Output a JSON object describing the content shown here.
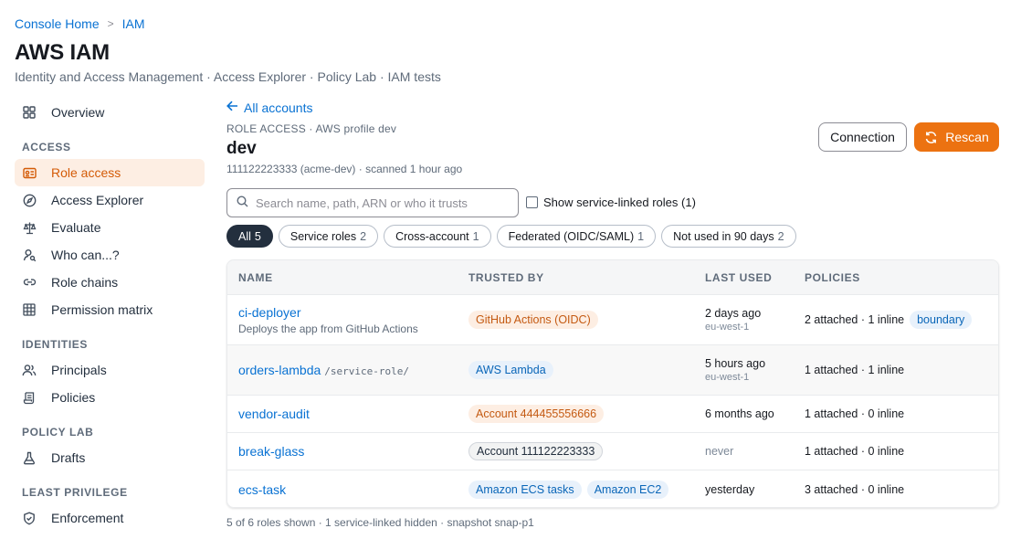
{
  "breadcrumb": {
    "home": "Console Home",
    "sep": ">",
    "current": "IAM"
  },
  "header": {
    "title": "AWS IAM",
    "subtitle": "Identity and Access Management · Access Explorer · Policy Lab · IAM tests"
  },
  "sidebar": {
    "items": [
      {
        "label": "Overview",
        "icon": "grid-icon"
      },
      {
        "section": "ACCESS"
      },
      {
        "label": "Role access",
        "icon": "id-card-icon",
        "active": true
      },
      {
        "label": "Access Explorer",
        "icon": "compass-icon"
      },
      {
        "label": "Evaluate",
        "icon": "scale-icon"
      },
      {
        "label": "Who can...?",
        "icon": "user-search-icon"
      },
      {
        "label": "Role chains",
        "icon": "link-icon"
      },
      {
        "label": "Permission matrix",
        "icon": "table-icon"
      },
      {
        "section": "IDENTITIES"
      },
      {
        "label": "Principals",
        "icon": "users-icon"
      },
      {
        "label": "Policies",
        "icon": "scroll-icon"
      },
      {
        "section": "POLICY LAB"
      },
      {
        "label": "Drafts",
        "icon": "flask-icon"
      },
      {
        "section": "LEAST PRIVILEGE"
      },
      {
        "label": "Enforcement",
        "icon": "shield-icon"
      }
    ],
    "labels": {
      "overview": "Overview",
      "access": "ACCESS",
      "role_access": "Role access",
      "access_explorer": "Access Explorer",
      "evaluate": "Evaluate",
      "who_can": "Who can...?",
      "role_chains": "Role chains",
      "permission_matrix": "Permission matrix",
      "identities": "IDENTITIES",
      "principals": "Principals",
      "policies": "Policies",
      "policy_lab": "POLICY LAB",
      "drafts": "Drafts",
      "least_privilege": "LEAST PRIVILEGE",
      "enforcement": "Enforcement"
    }
  },
  "main": {
    "back_link": "All accounts",
    "overline": "ROLE ACCESS · AWS profile dev",
    "title": "dev",
    "meta": "111122223333 (acme-dev) · scanned 1 hour ago",
    "connection_button": "Connection",
    "rescan_button": "Rescan",
    "search_placeholder": "Search name, path, ARN or who it trusts",
    "show_service_linked": "Show service-linked roles (1)",
    "chips": [
      {
        "label": "All",
        "count": "5",
        "active": true
      },
      {
        "label": "Service roles",
        "count": "2"
      },
      {
        "label": "Cross-account",
        "count": "1"
      },
      {
        "label": "Federated (OIDC/SAML)",
        "count": "1"
      },
      {
        "label": "Not used in 90 days",
        "count": "2"
      }
    ],
    "table": {
      "headers": [
        "NAME",
        "TRUSTED BY",
        "LAST USED",
        "POLICIES"
      ],
      "rows": [
        {
          "name": "ci-deployer",
          "path": "",
          "description": "Deploys the app from GitHub Actions",
          "trusted": [
            {
              "label": "GitHub Actions (OIDC)",
              "tone": "orange"
            }
          ],
          "last_used": "2 days ago",
          "region": "eu-west-1",
          "policies": "2 attached · 1 inline",
          "badge": "boundary"
        },
        {
          "name": "orders-lambda",
          "path": "/service-role/",
          "description": "",
          "trusted": [
            {
              "label": "AWS Lambda",
              "tone": "blue"
            }
          ],
          "last_used": "5 hours ago",
          "region": "eu-west-1",
          "policies": "1 attached · 1 inline",
          "badge": ""
        },
        {
          "name": "vendor-audit",
          "path": "",
          "description": "",
          "trusted": [
            {
              "label": "Account 444455556666",
              "tone": "orange"
            }
          ],
          "last_used": "6 months ago",
          "region": "",
          "policies": "1 attached · 0 inline",
          "badge": ""
        },
        {
          "name": "break-glass",
          "path": "",
          "description": "",
          "trusted": [
            {
              "label": "Account 111122223333",
              "tone": "gray"
            }
          ],
          "last_used": "never",
          "region": "",
          "policies": "1 attached · 0 inline",
          "badge": ""
        },
        {
          "name": "ecs-task",
          "path": "",
          "description": "",
          "trusted": [
            {
              "label": "Amazon ECS tasks",
              "tone": "blue"
            },
            {
              "label": "Amazon EC2",
              "tone": "blue"
            }
          ],
          "last_used": "yesterday",
          "region": "",
          "policies": "3 attached · 0 inline",
          "badge": ""
        }
      ]
    },
    "footer": "5 of 6 roles shown · 1 service-linked hidden · snapshot snap-p1"
  },
  "colors": {
    "accent": "#ec7211",
    "link": "#0972d3",
    "active_bg": "#fdeee3"
  }
}
